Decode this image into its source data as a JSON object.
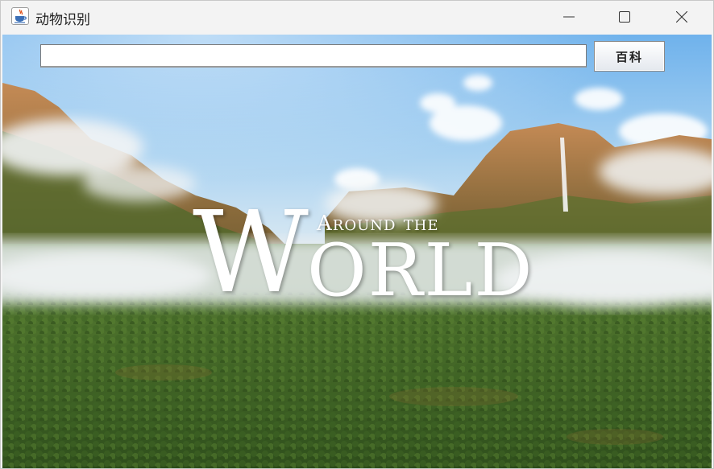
{
  "window": {
    "title": "动物识别"
  },
  "titlebar_icons": {
    "app": "java-cup-icon",
    "minimize": "minimize-icon",
    "maximize": "maximize-icon",
    "close": "close-icon"
  },
  "search": {
    "value": "",
    "placeholder": ""
  },
  "toolbar": {
    "baike_label": "百科"
  },
  "banner": {
    "line1": "Around the",
    "initial": "W",
    "rest": "ORLD"
  },
  "colors": {
    "sky": "#8ec3ea",
    "forest": "#3f6a22",
    "mist": "#e6ecef",
    "cliff": "#b07a4a"
  }
}
